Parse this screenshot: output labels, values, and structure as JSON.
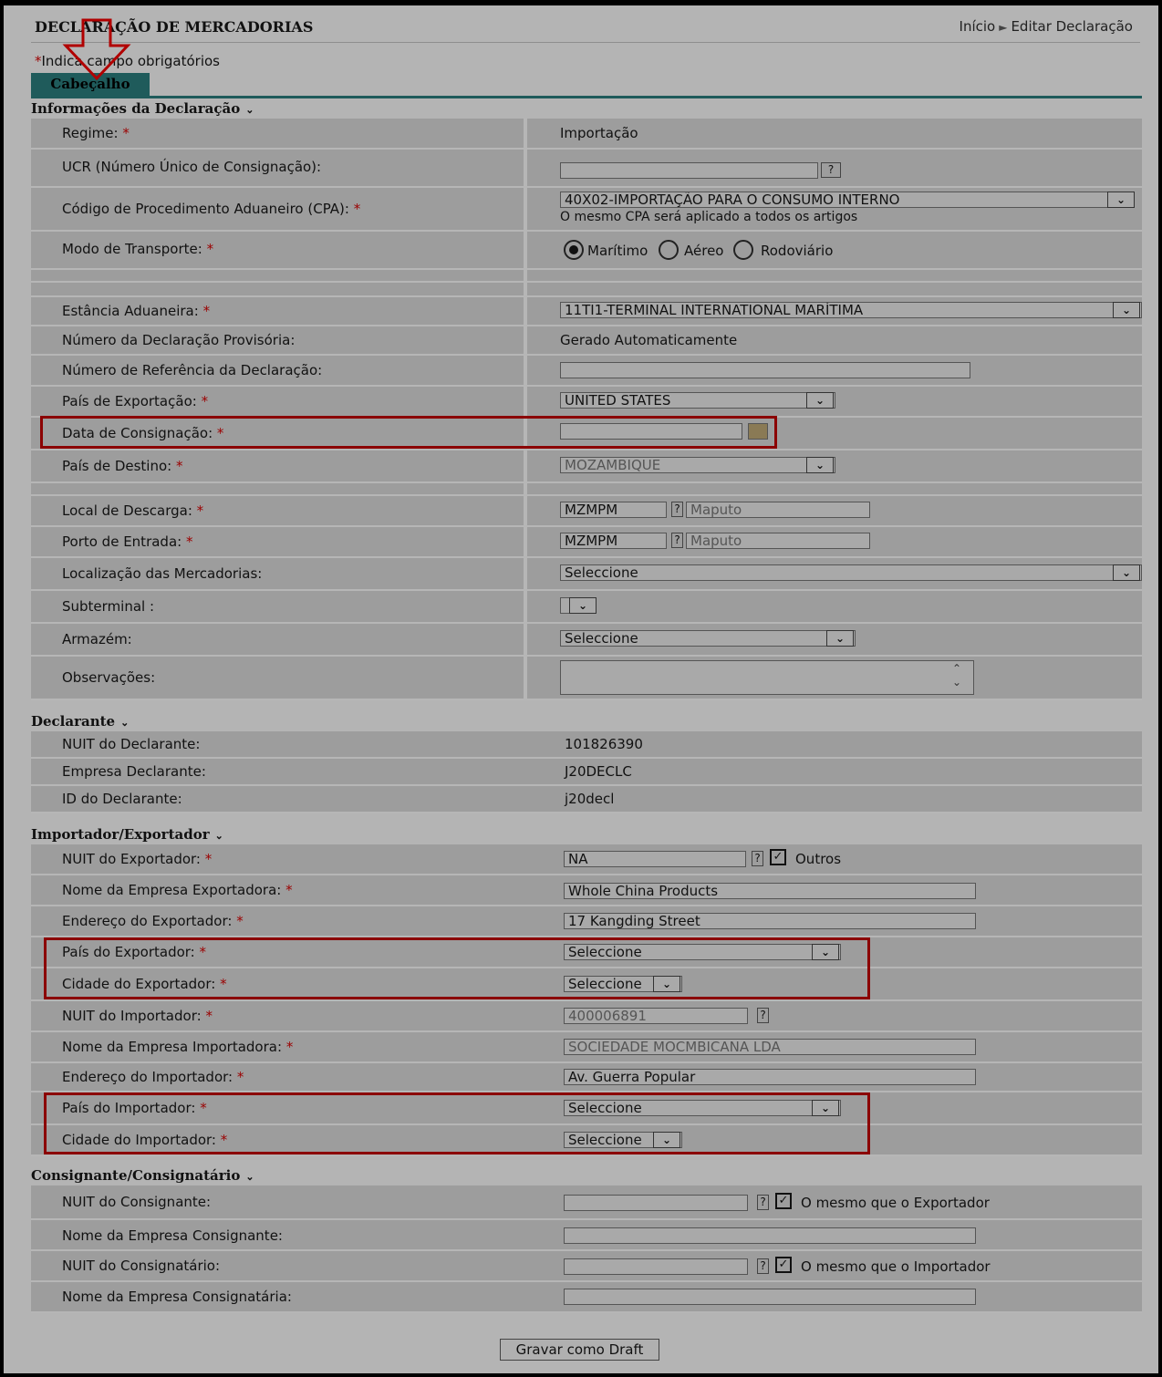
{
  "header": {
    "title": "DECLARAÇÃO DE MERCADORIAS",
    "breadcrumb_home": "Início",
    "breadcrumb_current": "Editar Declaração",
    "required_note_star": "*",
    "required_note": "Indica campo obrigatórios",
    "tab_label": "Cabeçalho"
  },
  "sections": {
    "info": "Informações da Declaração",
    "declarante": "Declarante",
    "impexp": "Importador/Exportador",
    "consign": "Consignante/Consignatário"
  },
  "info": {
    "regime_label": "Regime:",
    "regime_value": "Importação",
    "ucr_label": "UCR (Número Único de Consignação):",
    "cpa_label": "Código de Procedimento Aduaneiro (CPA):",
    "cpa_value": "40X02-IMPORTAÇÃO PARA O CONSUMO INTERNO",
    "cpa_note": "O mesmo CPA será aplicado a todos os artigos",
    "transport_label": "Modo de Transporte:",
    "transport_options": [
      "Marítimo",
      "Aéreo",
      "Rodoviário"
    ],
    "estancia_label": "Estância Aduaneira:",
    "estancia_value": "11TI1-TERMINAL INTERNATIONAL MARÍTIMA",
    "provisoria_label": "Número da Declaração Provisória:",
    "provisoria_value": "Gerado Automaticamente",
    "referencia_label": "Número de Referência da Declaração:",
    "pais_export_label": "País de Exportação:",
    "pais_export_value": "UNITED STATES",
    "data_consig_label": "Data de Consignação:",
    "pais_destino_label": "País de Destino:",
    "pais_destino_value": "MOZAMBIQUE",
    "local_descarga_label": "Local de Descarga:",
    "local_descarga_code": "MZMPM",
    "local_descarga_name": "Maputo",
    "porto_label": "Porto de Entrada:",
    "porto_code": "MZMPM",
    "porto_name": "Maputo",
    "localizacao_label": "Localização das Mercadorias:",
    "localizacao_value": "Seleccione",
    "subterminal_label": "Subterminal :",
    "armazem_label": "Armazém:",
    "armazem_value": "Seleccione",
    "observacoes_label": "Observações:"
  },
  "declarante": {
    "nuit_label": "NUIT do Declarante:",
    "nuit_value": "101826390",
    "empresa_label": "Empresa Declarante:",
    "empresa_value": "J20DECLC",
    "id_label": "ID do Declarante:",
    "id_value": "j20decl"
  },
  "impexp": {
    "nuit_exp_label": "NUIT do Exportador:",
    "nuit_exp_value": "NA",
    "outros_label": "Outros",
    "nome_exp_label": "Nome da Empresa Exportadora:",
    "nome_exp_value": "Whole China Products",
    "end_exp_label": "Endereço do Exportador:",
    "end_exp_value": "17 Kangding Street",
    "pais_exp_label": "País do Exportador:",
    "pais_exp_value": "Seleccione",
    "cidade_exp_label": "Cidade do Exportador:",
    "cidade_exp_value": "Seleccione",
    "nuit_imp_label": "NUIT do Importador:",
    "nuit_imp_value": "400006891",
    "nome_imp_label": "Nome da Empresa Importadora:",
    "nome_imp_value": "SOCIEDADE MOCMBICANA LDA",
    "end_imp_label": "Endereço do Importador:",
    "end_imp_value": "Av. Guerra Popular",
    "pais_imp_label": "País do Importador:",
    "pais_imp_value": "Seleccione",
    "cidade_imp_label": "Cidade do Importador:",
    "cidade_imp_value": "Seleccione"
  },
  "consign": {
    "nuit_consignante_label": "NUIT do Consignante:",
    "mesmo_exp_label": "O mesmo que o Exportador",
    "nome_consignante_label": "Nome da Empresa Consignante:",
    "nuit_consignatario_label": "NUIT do Consignatário:",
    "mesmo_imp_label": "O mesmo que o Importador",
    "nome_consignatario_label": "Nome da Empresa Consignatária:"
  },
  "footer": {
    "save_draft": "Gravar como Draft"
  },
  "icons": {
    "dropdown": "chevron-down-icon",
    "help": "help-icon",
    "calendar": "calendar-icon",
    "arrow": "down-arrow-annotation-icon"
  },
  "colors": {
    "tab": "#1f5b5b",
    "required_star": "#9b0000",
    "highlight": "#8b0000",
    "annotation_arrow": "#b10000"
  }
}
